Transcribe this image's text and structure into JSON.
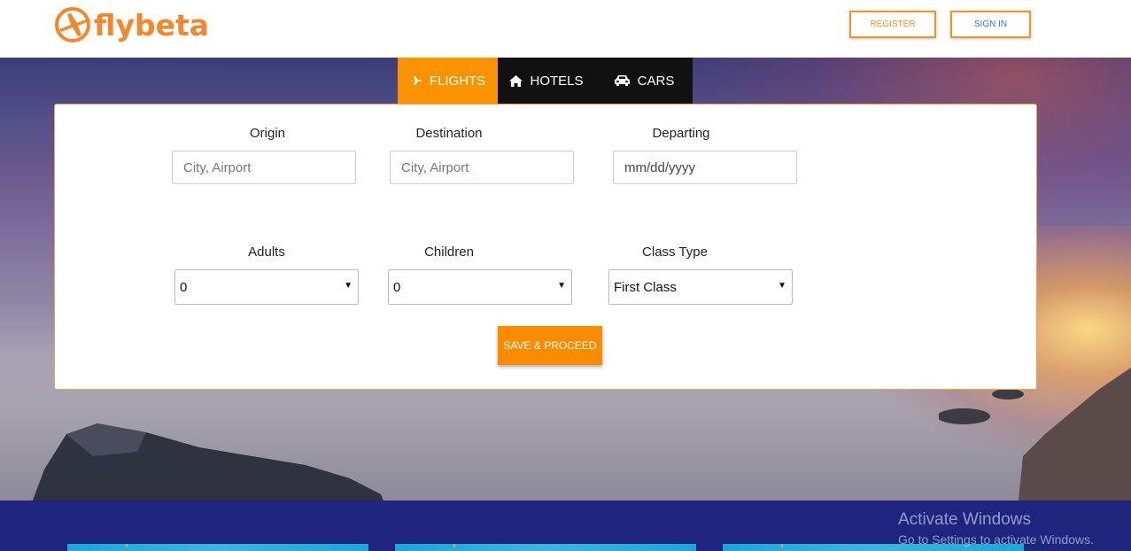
{
  "brand": {
    "name": "flybeta",
    "logo_icon": "airplane-circle-icon",
    "color": "#f5862b"
  },
  "header": {
    "register_label": "REGISTER",
    "signin_label": "SIGN IN"
  },
  "tabs": [
    {
      "label": "FLIGHTS",
      "icon": "plane-icon",
      "active": true
    },
    {
      "label": "HOTELS",
      "icon": "home-icon",
      "active": false
    },
    {
      "label": "CARS",
      "icon": "car-icon",
      "active": false
    }
  ],
  "form": {
    "origin": {
      "label": "Origin",
      "placeholder": "City, Airport"
    },
    "destination": {
      "label": "Destination",
      "placeholder": "City, Airport"
    },
    "departing": {
      "label": "Departing",
      "placeholder": "mm/dd/yyyy"
    },
    "adults": {
      "label": "Adults",
      "value": "0"
    },
    "children": {
      "label": "Children",
      "value": "0"
    },
    "class_type": {
      "label": "Class Type",
      "value": "First Class"
    },
    "submit_label": "SAVE & PROCEED"
  },
  "watermark": {
    "title": "Activate Windows",
    "subtitle": "Go to Settings to activate Windows."
  },
  "colors": {
    "accent": "#fb9300",
    "tab_bg": "#111111",
    "band": "#1f257e",
    "signin_text": "#2a7dd1"
  }
}
